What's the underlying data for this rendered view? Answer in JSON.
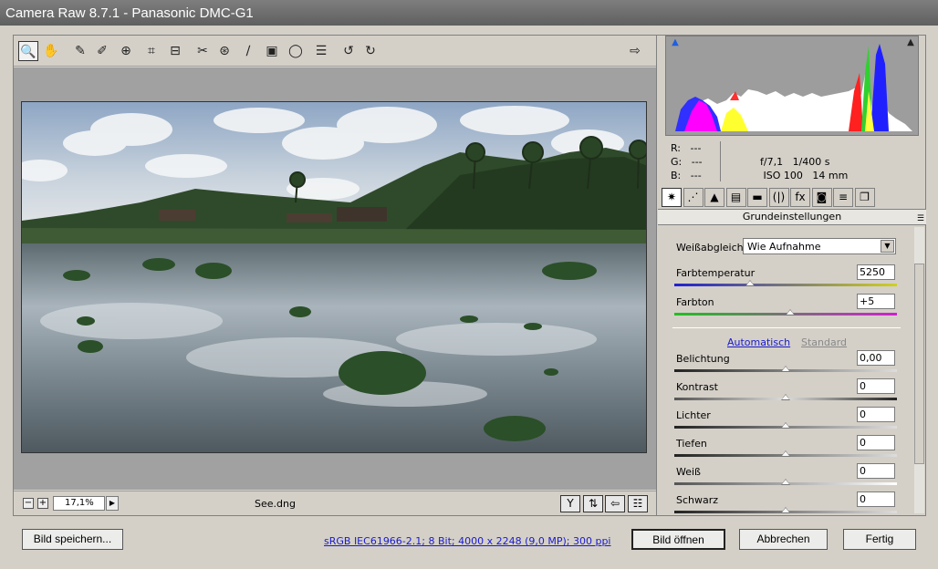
{
  "window": {
    "title": "Camera Raw 8.7.1 - Panasonic DMC-G1"
  },
  "toolbar": {
    "tools": [
      {
        "icon": "zoom-icon",
        "glyph": "🔍"
      },
      {
        "icon": "hand-icon",
        "glyph": "✋"
      },
      {
        "icon": "eyedropper-icon",
        "glyph": "✎"
      },
      {
        "icon": "color-sampler-icon",
        "glyph": "✐"
      },
      {
        "icon": "targeted-adjustment-icon",
        "glyph": "⊕"
      },
      {
        "icon": "crop-icon",
        "glyph": "⌗"
      },
      {
        "icon": "straighten-icon",
        "glyph": "⊟"
      },
      {
        "icon": "spot-removal-icon",
        "glyph": "✂"
      },
      {
        "icon": "red-eye-icon",
        "glyph": "⊛"
      },
      {
        "icon": "adjustment-brush-icon",
        "glyph": "∕"
      },
      {
        "icon": "graduated-filter-icon",
        "glyph": "▣"
      },
      {
        "icon": "radial-filter-icon",
        "glyph": "◯"
      },
      {
        "icon": "preferences-icon",
        "glyph": "☰"
      },
      {
        "icon": "rotate-left-icon",
        "glyph": "↺"
      },
      {
        "icon": "rotate-right-icon",
        "glyph": "↻"
      }
    ],
    "export_icon": "⇨"
  },
  "preview": {
    "zoom_value": "17,1%",
    "zoom_out": "−",
    "zoom_in": "+",
    "filename": "See.dng"
  },
  "histogram": {
    "readout": {
      "r_label": "R:",
      "r_value": "---",
      "g_label": "G:",
      "g_value": "---",
      "b_label": "B:",
      "b_value": "---",
      "aperture": "f/7,1",
      "shutter": "1/400 s",
      "iso": "ISO 100",
      "focal": "14 mm"
    }
  },
  "tabs": [
    {
      "name": "tab-basic",
      "glyph": "✷"
    },
    {
      "name": "tab-tone-curve",
      "glyph": "⋰"
    },
    {
      "name": "tab-detail",
      "glyph": "▲"
    },
    {
      "name": "tab-hsl",
      "glyph": "▤"
    },
    {
      "name": "tab-split-toning",
      "glyph": "▬"
    },
    {
      "name": "tab-lens-corrections",
      "glyph": "(|)"
    },
    {
      "name": "tab-effects",
      "glyph": "fx"
    },
    {
      "name": "tab-camera-calibration",
      "glyph": "◙"
    },
    {
      "name": "tab-presets",
      "glyph": "≡"
    },
    {
      "name": "tab-snapshots",
      "glyph": "❐"
    }
  ],
  "panel": {
    "title": "Grundeinstellungen",
    "wb_label": "Weißabgleich:",
    "wb_value": "Wie Aufnahme",
    "temp_label": "Farbtemperatur",
    "temp_value": "5250",
    "tint_label": "Farbton",
    "tint_value": "+5",
    "auto_link": "Automatisch",
    "default_link": "Standard",
    "sliders": [
      {
        "label": "Belichtung",
        "value": "0,00",
        "level": 0.5
      },
      {
        "label": "Kontrast",
        "value": "0",
        "level": 0.5
      },
      {
        "label": "Lichter",
        "value": "0",
        "level": 0.5
      },
      {
        "label": "Tiefen",
        "value": "0",
        "level": 0.5
      },
      {
        "label": "Weiß",
        "value": "0",
        "level": 0.5
      },
      {
        "label": "Schwarz",
        "value": "0",
        "level": 0.5
      }
    ],
    "temp_level": 0.34,
    "tint_level": 0.52
  },
  "footer": {
    "save_label": "Bild speichern...",
    "info_link": "sRGB IEC61966-2.1; 8 Bit; 4000 x 2248 (9,0 MP); 300 ppi",
    "open_label": "Bild öffnen",
    "cancel_label": "Abbrechen",
    "done_label": "Fertig"
  },
  "colors": {
    "link": "#1a1ad0",
    "title_bar": "#6e6e6e",
    "chrome": "#d4d0c8"
  }
}
